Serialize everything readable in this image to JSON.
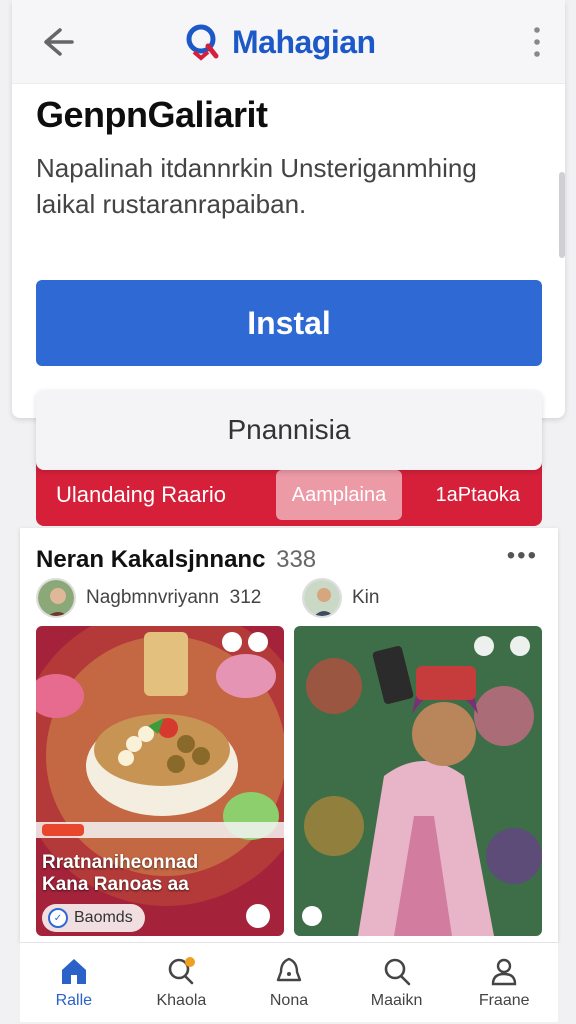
{
  "app": {
    "brand": "Mahagian",
    "brand_color": "#1c58c8"
  },
  "icons": {
    "back": "back-arrow-icon",
    "more": "more-vertical-icon",
    "logo": "search-logo-icon"
  },
  "listing": {
    "title": "GenpnGaliarit",
    "description": "Napalinah itdannrkin Unsteriganmhing laikal rustaranrapaiban.",
    "install_label": "Instal",
    "install_color": "#2f69d3"
  },
  "panel": {
    "label": "Pnannisia"
  },
  "tabs": [
    {
      "label": "Ulandaing Raario"
    },
    {
      "label": "Aamplaina"
    },
    {
      "label": "1aPtaoka"
    }
  ],
  "feed": {
    "title": "Neran Kakalsjnnanc",
    "count": "338",
    "more": "•••",
    "posts": [
      {
        "author": "Nagbmnvriyann",
        "author_count": "312",
        "caption_line1": "Rratnaniheonnad",
        "caption_line2": "Kana Ranoas aa",
        "badge": "Baomds"
      },
      {
        "author": "Kin"
      }
    ]
  },
  "nav": [
    {
      "label": "Ralle",
      "icon": "home-icon",
      "active": true
    },
    {
      "label": "Khaola",
      "icon": "search-notification-icon",
      "active": false
    },
    {
      "label": "Nona",
      "icon": "bell-icon",
      "active": false
    },
    {
      "label": "Maaikn",
      "icon": "search-icon",
      "active": false
    },
    {
      "label": "Fraane",
      "icon": "profile-icon",
      "active": false
    }
  ]
}
